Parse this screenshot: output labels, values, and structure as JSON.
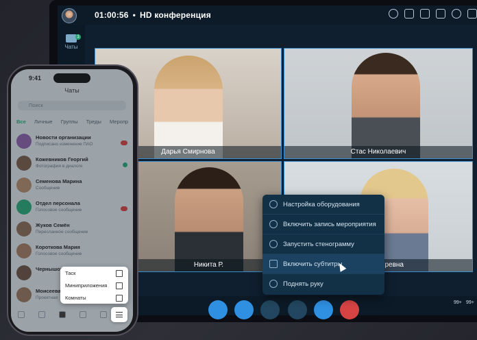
{
  "conference": {
    "timer": "01:00:56",
    "separator": "•",
    "title": "HD конференция"
  },
  "rail": {
    "label": "Чаты",
    "badge": "1"
  },
  "participants": [
    {
      "name": "Дарья Смирнова"
    },
    {
      "name": "Стас Николаевич"
    },
    {
      "name": "Никита Р."
    },
    {
      "name": "оревна"
    }
  ],
  "menu": {
    "items": [
      {
        "label": "Настройка оборудования"
      },
      {
        "label": "Включить запись мероприятия"
      },
      {
        "label": "Запустить стенограмму"
      },
      {
        "label": "Включить субтитры"
      },
      {
        "label": "Поднять руку"
      }
    ]
  },
  "callbar": {
    "count1": "99+",
    "count2": "99+"
  },
  "phone": {
    "time": "9:41",
    "header": "Чаты",
    "search_placeholder": "Поиск",
    "tabs": [
      "Все",
      "Личные",
      "Группы",
      "Треды",
      "Меропр"
    ],
    "chats": [
      {
        "name": "Новости организации",
        "msg": "Подписано изменение ПАО"
      },
      {
        "name": "Кожевников Георгий",
        "msg": "Фотография в диалоге"
      },
      {
        "name": "Семенова Марина",
        "msg": "Сообщение"
      },
      {
        "name": "Отдел персонала",
        "msg": "Голосовое сообщение"
      },
      {
        "name": "Жуков Семён",
        "msg": "Пересланное сообщение"
      },
      {
        "name": "Короткова Мария",
        "msg": "Голосовое сообщение"
      },
      {
        "name": "Чернышова",
        "msg": ""
      },
      {
        "name": "Моисеева Мария",
        "msg": "Проектная"
      }
    ],
    "popup": [
      {
        "label": "Таск"
      },
      {
        "label": "Миниприложения"
      },
      {
        "label": "Комнаты"
      }
    ]
  },
  "colors": {
    "accent": "#2aa876",
    "highlight": "#3a8fd1",
    "danger": "#d64343"
  }
}
